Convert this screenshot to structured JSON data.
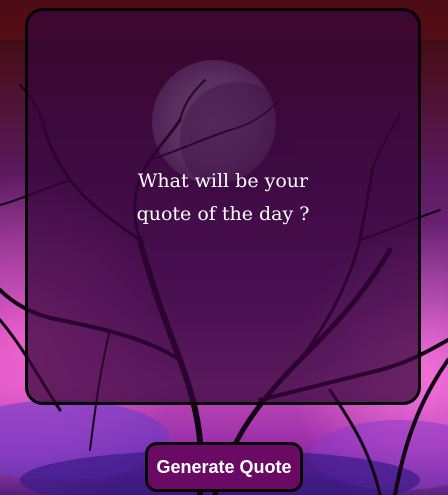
{
  "quote": {
    "text": "What will be your quote of the day ?"
  },
  "actions": {
    "generate_label": "Generate Quote"
  },
  "colors": {
    "card_bg": "#34063a",
    "button_bg": "#6b0a64",
    "text": "#ffffff"
  }
}
